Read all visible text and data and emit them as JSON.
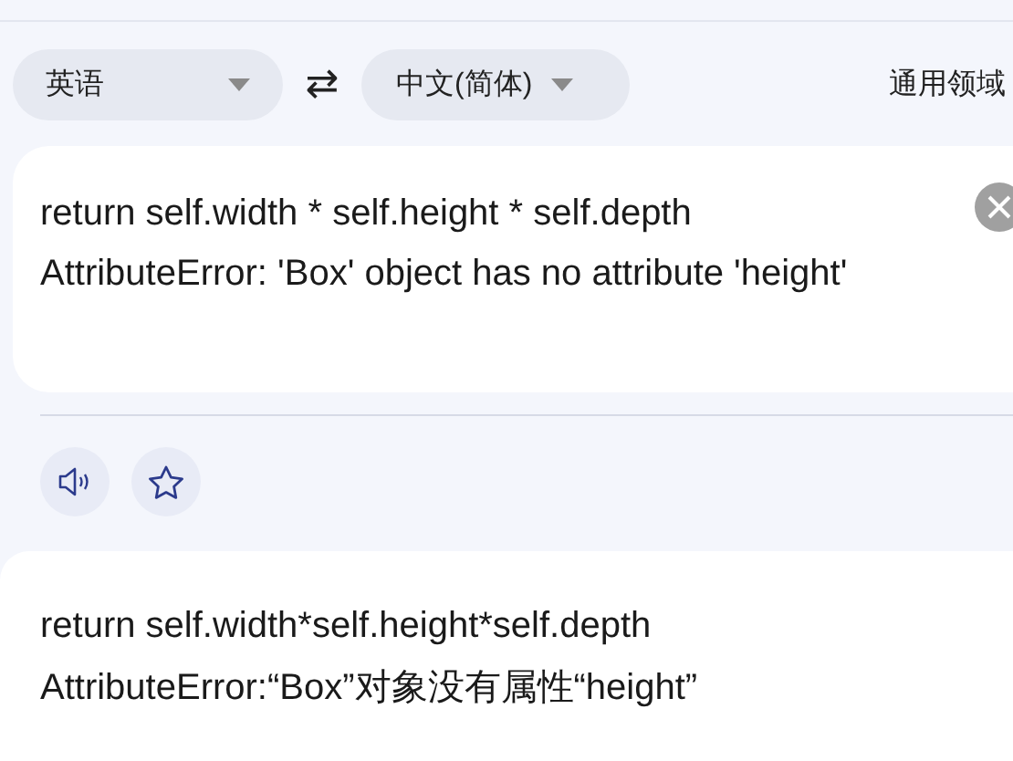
{
  "source_language": {
    "label": "英语"
  },
  "swap_symbol": "⇄",
  "target_language": {
    "label": "中文(简体)"
  },
  "domain": {
    "label": "通用领域"
  },
  "source_text": [
    "return self.width * self.height * self.depth",
    "AttributeError: 'Box' object has no attribute 'height'"
  ],
  "translation": [
    "return self.width*self.height*self.depth",
    "AttributeError:“Box”对象没有属性“height”"
  ]
}
